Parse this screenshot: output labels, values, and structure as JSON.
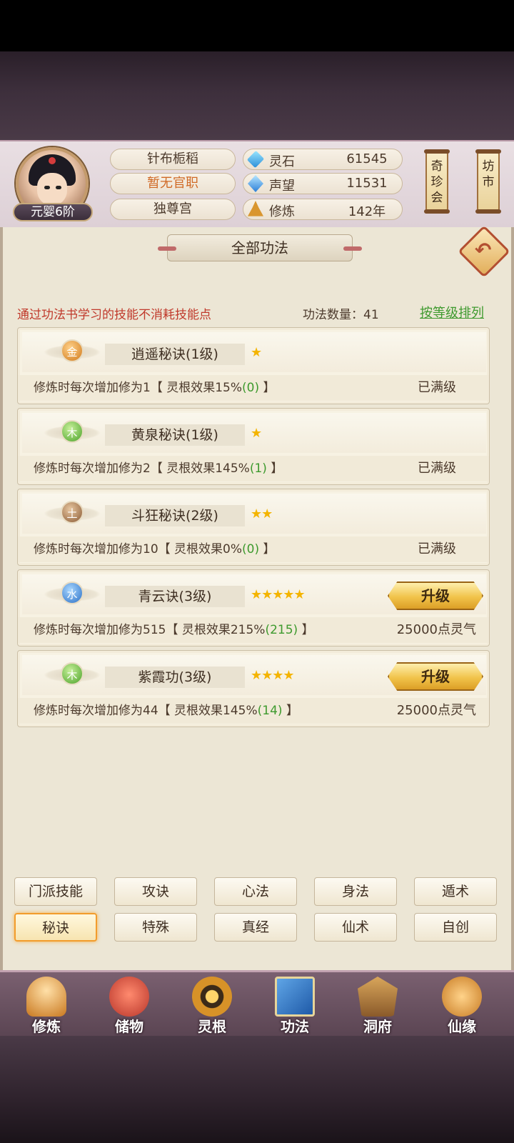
{
  "player": {
    "name": "针布栀稻",
    "title": "暂无官职",
    "sect": "独尊宫",
    "realm": "元婴6阶"
  },
  "stats": [
    {
      "icon": "spirit-stone-icon",
      "label": "灵石",
      "value": "61545"
    },
    {
      "icon": "reputation-icon",
      "label": "声望",
      "value": "11531"
    },
    {
      "icon": "cultivation-icon",
      "label": "修炼",
      "value": "142年"
    }
  ],
  "side_buttons": {
    "treasure": "奇珍会",
    "market": "坊市"
  },
  "panel": {
    "title": "全部功法",
    "hint": "通过功法书学习的技能不消耗技能点",
    "count_label": "功法数量：41",
    "sort_label": "按等级排列"
  },
  "skills": [
    {
      "element": "金",
      "element_key": "gold",
      "name": "逍遥秘诀(1级)",
      "stars": "★",
      "desc_a": "修炼时每次增加修为1【 灵根效果15%",
      "desc_b": "(0)",
      "desc_c": " 】",
      "status": "已满级",
      "upgrade": ""
    },
    {
      "element": "木",
      "element_key": "wood",
      "name": "黄泉秘诀(1级)",
      "stars": "★",
      "desc_a": "修炼时每次增加修为2【 灵根效果145%",
      "desc_b": "(1)",
      "desc_c": " 】",
      "status": "已满级",
      "upgrade": ""
    },
    {
      "element": "土",
      "element_key": "earth",
      "name": "斗狂秘诀(2级)",
      "stars": "★★",
      "desc_a": "修炼时每次增加修为10【 灵根效果0%",
      "desc_b": "(0)",
      "desc_c": " 】",
      "status": "已满级",
      "upgrade": ""
    },
    {
      "element": "水",
      "element_key": "water",
      "name": "青云诀(3级)",
      "stars": "★★★★★",
      "desc_a": "修炼时每次增加修为515【 灵根效果215%",
      "desc_b": "(215)",
      "desc_c": " 】",
      "status": "25000点灵气",
      "upgrade": "升级"
    },
    {
      "element": "木",
      "element_key": "wood",
      "name": "紫霞功(3级)",
      "stars": "★★★★",
      "desc_a": "修炼时每次增加修为44【 灵根效果145%",
      "desc_b": "(14)",
      "desc_c": " 】",
      "status": "25000点灵气",
      "upgrade": "升级"
    }
  ],
  "tabs": [
    {
      "label": "门派技能",
      "active": false
    },
    {
      "label": "攻诀",
      "active": false
    },
    {
      "label": "心法",
      "active": false
    },
    {
      "label": "身法",
      "active": false
    },
    {
      "label": "遁术",
      "active": false
    },
    {
      "label": "秘诀",
      "active": true
    },
    {
      "label": "特殊",
      "active": false
    },
    {
      "label": "真经",
      "active": false
    },
    {
      "label": "仙术",
      "active": false
    },
    {
      "label": "自创",
      "active": false
    }
  ],
  "bottom_nav": [
    {
      "icon": "cultivate-icon",
      "label": "修炼"
    },
    {
      "icon": "storage-icon",
      "label": "储物"
    },
    {
      "icon": "spirit-root-icon",
      "label": "灵根"
    },
    {
      "icon": "skills-book-icon",
      "label": "功法"
    },
    {
      "icon": "cave-dwelling-icon",
      "label": "洞府"
    },
    {
      "icon": "fate-icon",
      "label": "仙缘"
    }
  ],
  "colors": {
    "hint_red": "#c0392b",
    "sort_green": "#3e9a2e",
    "active_tab": "#f29c2c",
    "upgrade_gold": "#f1c34a"
  }
}
